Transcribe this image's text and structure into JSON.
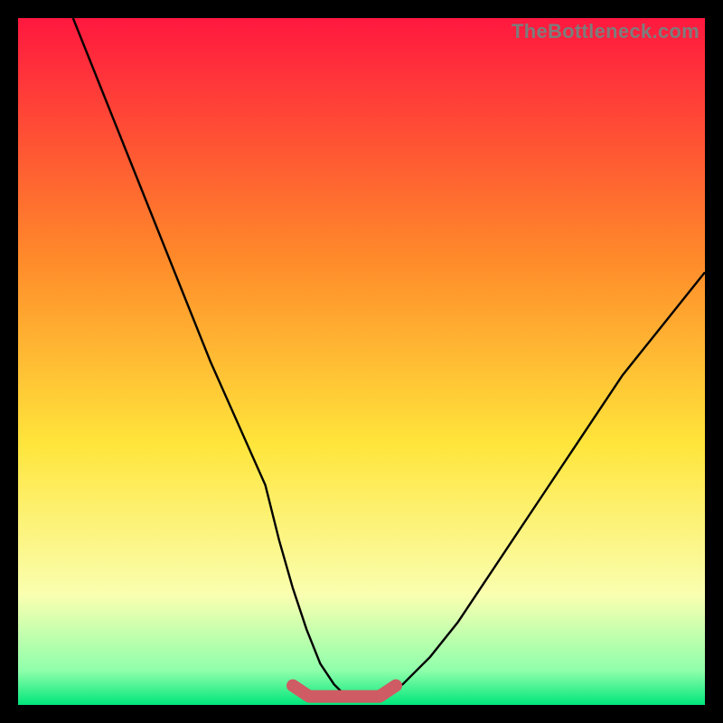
{
  "watermark": "TheBottleneck.com",
  "colors": {
    "gradient_top": "#ff183f",
    "gradient_mid": "#ffe53b",
    "gradient_bottom": "#00e67a",
    "curve": "#000000",
    "flat_segment": "#cf5b65",
    "frame_bg": "#000000"
  },
  "chart_data": {
    "type": "line",
    "title": "",
    "xlabel": "",
    "ylabel": "",
    "xlim": [
      0,
      100
    ],
    "ylim": [
      0,
      100
    ],
    "annotations": [],
    "series": [
      {
        "name": "bottleneck-curve",
        "x": [
          8,
          12,
          16,
          20,
          24,
          28,
          32,
          36,
          38,
          40,
          42,
          44,
          46,
          48,
          52,
          56,
          60,
          64,
          68,
          72,
          76,
          80,
          84,
          88,
          92,
          96,
          100
        ],
        "values": [
          100,
          90,
          80,
          70,
          60,
          50,
          41,
          32,
          24,
          17,
          11,
          6,
          3,
          1,
          1,
          3,
          7,
          12,
          18,
          24,
          30,
          36,
          42,
          48,
          53,
          58,
          63
        ]
      }
    ],
    "flat_segment": {
      "x_start": 40,
      "x_end": 55,
      "y": 1.5
    }
  }
}
